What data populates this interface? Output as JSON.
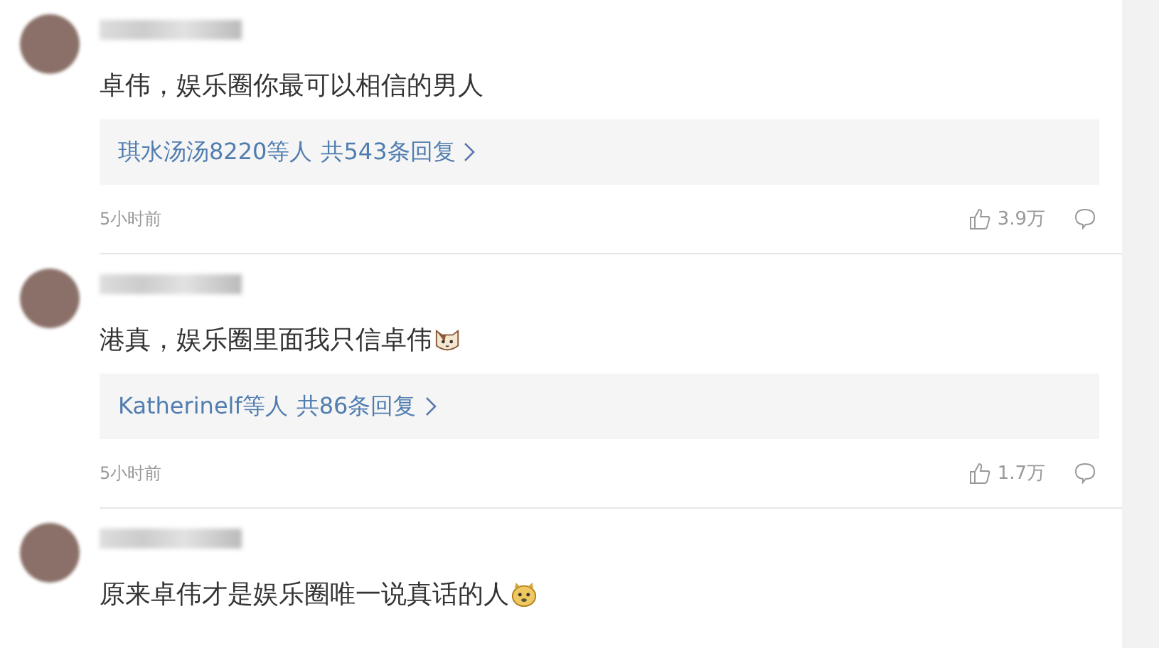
{
  "comments": [
    {
      "text": "卓伟，娱乐圈你最可以相信的男人",
      "replies": {
        "users": "琪水汤汤8220等人",
        "count": "共543条回复"
      },
      "time": "5小时前",
      "likes": "3.9万"
    },
    {
      "text": "港真，娱乐圈里面我只信卓伟",
      "emoji": {
        "kind": "cat"
      },
      "replies": {
        "users": "Katherinelf等人",
        "count": "共86条回复"
      },
      "time": "5小时前",
      "likes": "1.7万"
    },
    {
      "text": "原来卓伟才是娱乐圈唯一说真话的人",
      "emoji": {
        "kind": "doge"
      }
    }
  ]
}
